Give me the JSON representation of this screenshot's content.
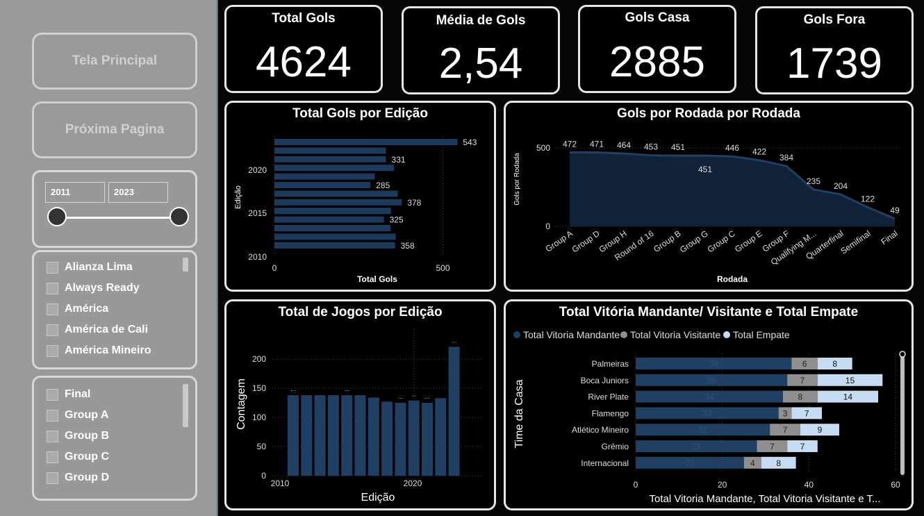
{
  "sidebar": {
    "buttons": {
      "main": "Tela Principal",
      "next": "Próxima Pagina"
    },
    "range": {
      "start": "2011",
      "end": "2023"
    },
    "teams": [
      "Alianza Lima",
      "Always Ready",
      "América",
      "América de Cali",
      "América Mineiro"
    ],
    "rounds": [
      "Final",
      "Group A",
      "Group B",
      "Group C",
      "Group D"
    ]
  },
  "kpis": [
    {
      "title": "Total Gols",
      "value": "4624"
    },
    {
      "title": "Média de Gols",
      "value": "2,54"
    },
    {
      "title": "Gols Casa",
      "value": "2885"
    },
    {
      "title": "Gols Fora",
      "value": "1739"
    }
  ],
  "colors": {
    "bar": "#1f3f63",
    "bar_dark": "#1b3a5c",
    "visitor": "#8f8f8f",
    "draw": "#c6dcf2",
    "text": "#ffffff"
  },
  "chart_data": [
    {
      "id": "gols_edicao",
      "type": "bar",
      "orientation": "horizontal",
      "title": "Total Gols por Edição",
      "xlabel": "Total Gols",
      "ylabel": "Edição",
      "y_ticks": [
        "2010",
        "2015",
        "2020"
      ],
      "x_ticks": [
        "0",
        "500"
      ],
      "xlim": [
        0,
        600
      ],
      "categories": [
        2023,
        2022,
        2021,
        2020,
        2019,
        2018,
        2017,
        2016,
        2015,
        2014,
        2013,
        2012,
        2011
      ],
      "values": [
        543,
        331,
        331,
        355,
        298,
        285,
        366,
        378,
        346,
        325,
        345,
        360,
        358
      ],
      "data_labels": {
        "2023": "543",
        "2021": "331",
        "2018": "285",
        "2016": "378",
        "2014": "325",
        "2011": "358"
      }
    },
    {
      "id": "gols_rodada",
      "type": "area",
      "title": "Gols por Rodada por Rodada",
      "xlabel": "Rodada",
      "ylabel": "Gols por Rodada",
      "y_ticks": [
        "0",
        "500"
      ],
      "ylim": [
        0,
        550
      ],
      "categories": [
        "Group A",
        "Group D",
        "Group H",
        "Round of 16",
        "Group B",
        "Group G",
        "Group C",
        "Group E",
        "Group F",
        "Qualifying M...",
        "Quarterfinal",
        "Semifinal",
        "Final"
      ],
      "values": [
        472,
        471,
        464,
        453,
        451,
        451,
        446,
        422,
        384,
        235,
        204,
        122,
        49
      ]
    },
    {
      "id": "jogos_edicao",
      "type": "bar",
      "title": "Total de Jogos por Edição",
      "xlabel": "Edição",
      "ylabel": "Contagem",
      "x_ticks": [
        "2010",
        "2020"
      ],
      "y_ticks": [
        "0",
        "50",
        "100",
        "150",
        "200"
      ],
      "ylim": [
        0,
        240
      ],
      "categories": [
        2011,
        2012,
        2013,
        2014,
        2015,
        2016,
        2017,
        2018,
        2019,
        2020,
        2021,
        2022,
        2023
      ],
      "values": [
        138,
        138,
        138,
        138,
        138,
        138,
        134,
        127,
        125,
        129,
        125,
        133,
        221
      ]
    },
    {
      "id": "vitorias",
      "type": "bar",
      "orientation": "horizontal",
      "stacked": true,
      "title": "Total Vitória Mandante/ Visitante e Total Empate",
      "xlabel": "Total Vitoria Mandante, Total Vitoria Visitante e T...",
      "ylabel": "Time da Casa",
      "x_ticks": [
        "0",
        "20",
        "40",
        "60"
      ],
      "xlim": [
        0,
        60
      ],
      "categories": [
        "Palmeiras",
        "Boca Juniors",
        "River Plate",
        "Flamengo",
        "Atlético Mineiro",
        "Grêmio",
        "Internacional"
      ],
      "series": [
        {
          "name": "Total Vitoria Mandante",
          "values": [
            36,
            35,
            34,
            33,
            31,
            28,
            25
          ]
        },
        {
          "name": "Total Vitoria Visitante",
          "values": [
            6,
            7,
            8,
            3,
            7,
            7,
            4
          ]
        },
        {
          "name": "Total Empate",
          "values": [
            8,
            15,
            14,
            7,
            9,
            7,
            8
          ]
        }
      ],
      "mandante_labels": [
        "36",
        "35",
        "34",
        "33",
        "31",
        "28",
        "25"
      ]
    }
  ]
}
